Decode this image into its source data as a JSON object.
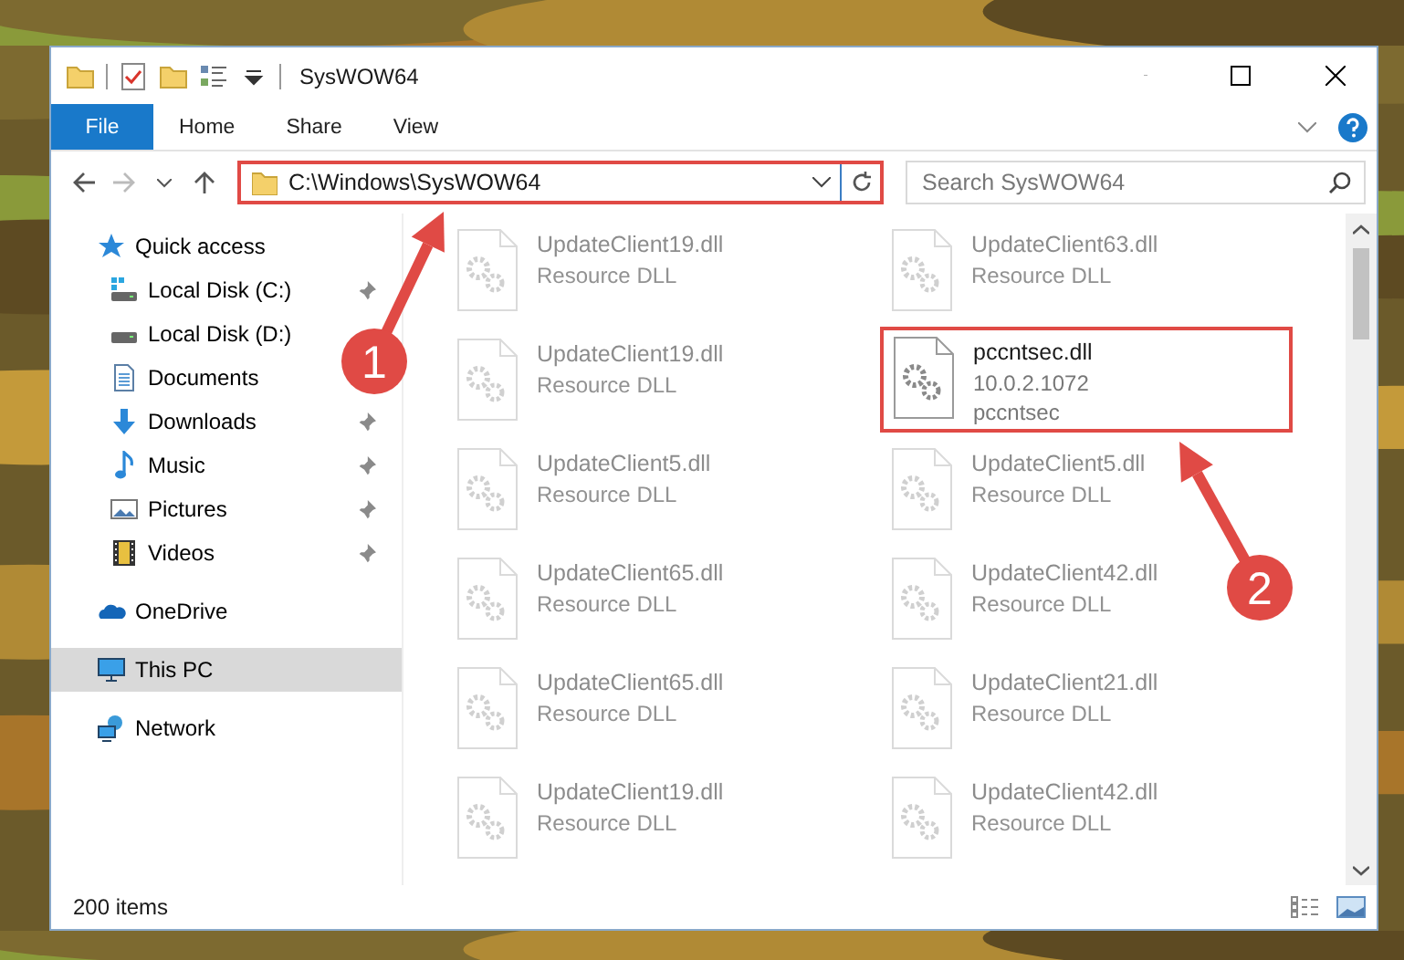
{
  "window": {
    "title": "SysWOW64"
  },
  "ribbon": {
    "tabs": [
      {
        "label": "File",
        "selected": true
      },
      {
        "label": "Home",
        "selected": false
      },
      {
        "label": "Share",
        "selected": false
      },
      {
        "label": "View",
        "selected": false
      }
    ]
  },
  "address_bar": {
    "path": "C:\\Windows\\SysWOW64",
    "highlighted": true
  },
  "search": {
    "placeholder": "Search SysWOW64"
  },
  "navigation": [
    {
      "label": "Quick access",
      "kind": "star",
      "selected": false,
      "children": [
        {
          "label": "Local Disk (C:)",
          "kind": "system-drive",
          "pinned": true,
          "selected": false
        },
        {
          "label": "Local Disk (D:)",
          "kind": "drive",
          "pinned": false,
          "selected": false
        },
        {
          "label": "Documents",
          "kind": "documents",
          "pinned": false,
          "selected": false
        },
        {
          "label": "Downloads",
          "kind": "downloads",
          "pinned": true,
          "selected": false
        },
        {
          "label": "Music",
          "kind": "music",
          "pinned": true,
          "selected": false
        },
        {
          "label": "Pictures",
          "kind": "pictures",
          "pinned": true,
          "selected": false
        },
        {
          "label": "Videos",
          "kind": "videos",
          "pinned": true,
          "selected": false
        }
      ]
    },
    {
      "label": "OneDrive",
      "kind": "cloud",
      "selected": false
    },
    {
      "label": "This PC",
      "kind": "computer",
      "selected": true
    },
    {
      "label": "Network",
      "kind": "network",
      "selected": false
    }
  ],
  "files": [
    {
      "name": "UpdateClient19.dll",
      "details": [
        "Resource DLL"
      ],
      "dimmed": true,
      "highlighted": false
    },
    {
      "name": "UpdateClient63.dll",
      "details": [
        "Resource DLL"
      ],
      "dimmed": true,
      "highlighted": false
    },
    {
      "name": "UpdateClient19.dll",
      "details": [
        "Resource DLL"
      ],
      "dimmed": true,
      "highlighted": false
    },
    {
      "name": "pccntsec.dll",
      "details": [
        "10.0.2.1072",
        "pccntsec"
      ],
      "dimmed": false,
      "highlighted": true
    },
    {
      "name": "UpdateClient5.dll",
      "details": [
        "Resource DLL"
      ],
      "dimmed": true,
      "highlighted": false
    },
    {
      "name": "UpdateClient5.dll",
      "details": [
        "Resource DLL"
      ],
      "dimmed": true,
      "highlighted": false
    },
    {
      "name": "UpdateClient65.dll",
      "details": [
        "Resource DLL"
      ],
      "dimmed": true,
      "highlighted": false
    },
    {
      "name": "UpdateClient42.dll",
      "details": [
        "Resource DLL"
      ],
      "dimmed": true,
      "highlighted": false
    },
    {
      "name": "UpdateClient65.dll",
      "details": [
        "Resource DLL"
      ],
      "dimmed": true,
      "highlighted": false
    },
    {
      "name": "UpdateClient21.dll",
      "details": [
        "Resource DLL"
      ],
      "dimmed": true,
      "highlighted": false
    },
    {
      "name": "UpdateClient19.dll",
      "details": [
        "Resource DLL"
      ],
      "dimmed": true,
      "highlighted": false
    },
    {
      "name": "UpdateClient42.dll",
      "details": [
        "Resource DLL"
      ],
      "dimmed": true,
      "highlighted": false
    }
  ],
  "status_bar": {
    "item_count": "200 items"
  },
  "annotations": [
    {
      "label": "1"
    },
    {
      "label": "2"
    }
  ]
}
